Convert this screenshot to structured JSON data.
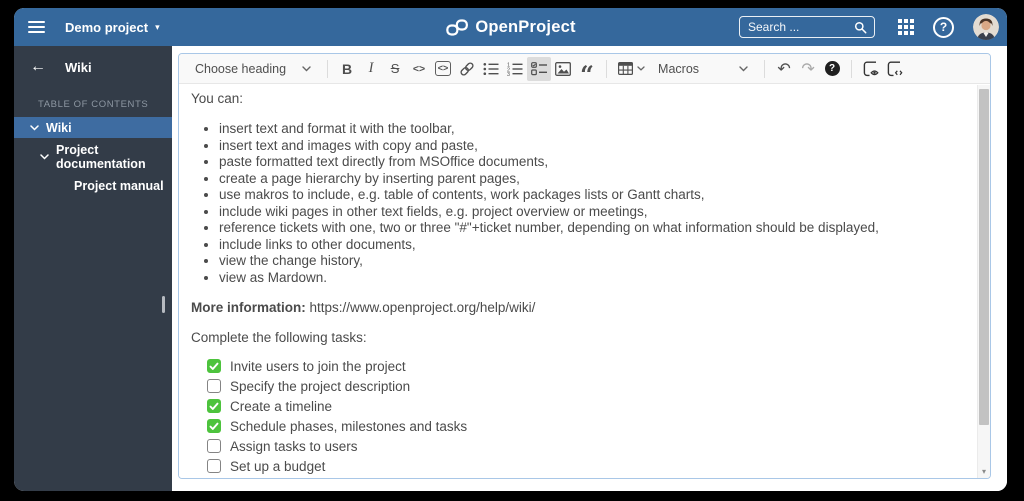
{
  "topbar": {
    "project_name": "Demo project",
    "logo_text": "OpenProject",
    "search_placeholder": "Search ..."
  },
  "sidebar": {
    "title": "Wiki",
    "toc_label": "TABLE OF CONTENTS",
    "items": [
      {
        "label": "Wiki",
        "selected": true
      },
      {
        "label": "Project documentation",
        "selected": false
      },
      {
        "label": "Project manual",
        "selected": false
      }
    ]
  },
  "toolbar": {
    "heading_label": "Choose heading",
    "bold_label": "B",
    "italic_label": "I",
    "strike_label": "S",
    "inline_code_label": "<>",
    "code_block_label": "<>",
    "quote_glyph": "“",
    "macros_label": "Macros",
    "undo_glyph": "↶",
    "redo_glyph": "↷",
    "help_glyph": "?",
    "source_glyph": "<>"
  },
  "editor": {
    "intro": "You can:",
    "bullets": [
      "insert text and format it with the toolbar,",
      "insert text and images with copy and paste,",
      "paste formatted text directly from MSOffice documents,",
      "create a page hierarchy by inserting parent pages,",
      "use makros to include, e.g. table of contents, work packages lists or Gantt charts,",
      "include wiki pages in other text fields, e.g. project overview or meetings,",
      "reference tickets with one, two or three \"#\"+ticket number, depending on what information should be displayed,",
      "include links to other documents,",
      "view the change history,",
      "view as Mardown."
    ],
    "more_info_label": "More information:",
    "more_info_url": "https://www.openproject.org/help/wiki/",
    "tasks_intro": "Complete the following tasks:",
    "tasks": [
      {
        "label": "Invite users to join the project",
        "checked": true
      },
      {
        "label": "Specify the project description",
        "checked": false
      },
      {
        "label": "Create a timeline",
        "checked": true
      },
      {
        "label": "Schedule phases, milestones and tasks",
        "checked": true
      },
      {
        "label": "Assign tasks to users",
        "checked": false
      },
      {
        "label": "Set up a budget",
        "checked": false
      },
      {
        "label": "",
        "checked": false
      }
    ]
  },
  "colors": {
    "header": "#35689c",
    "sidebar": "#333c48",
    "selected_item": "#3e6ca1",
    "checked_green": "#4dc33d",
    "editor_border": "#a9c7e7"
  }
}
